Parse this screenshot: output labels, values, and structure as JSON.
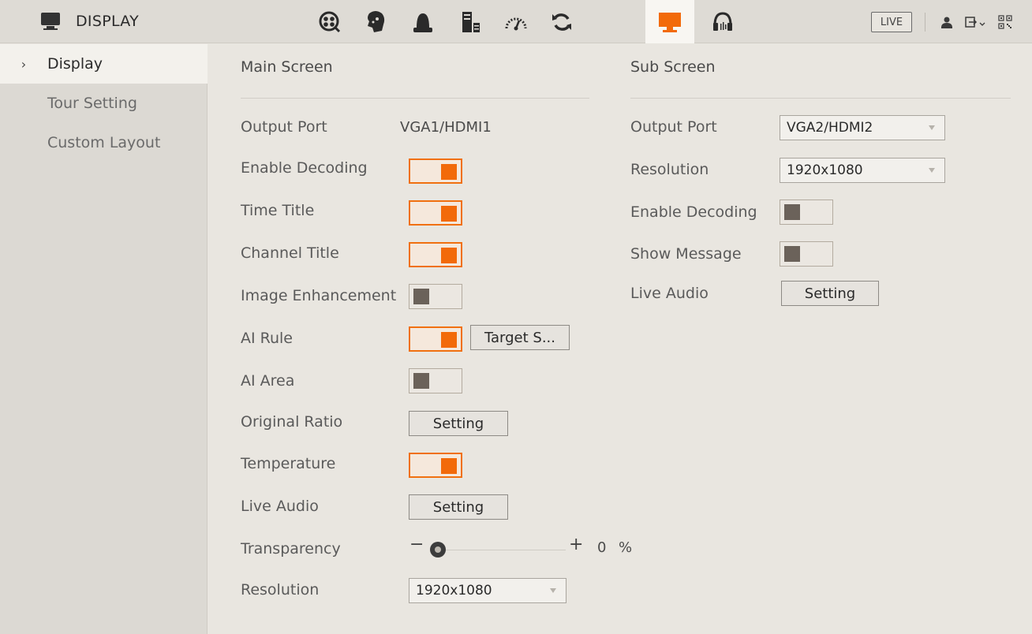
{
  "header": {
    "title": "DISPLAY",
    "nav_icons": [
      "search-video-icon",
      "face-ai-icon",
      "alarm-icon",
      "storage-icon",
      "network-speed-icon",
      "backup-icon",
      "display-icon",
      "audio-icon"
    ],
    "active_icon": "display-icon",
    "live_label": "LIVE",
    "right_icons": [
      "user-icon",
      "logout-icon",
      "qr-code-icon"
    ]
  },
  "sidebar": {
    "items": [
      {
        "label": "Display",
        "active": true
      },
      {
        "label": "Tour Setting",
        "active": false
      },
      {
        "label": "Custom Layout",
        "active": false
      }
    ]
  },
  "main_screen": {
    "title": "Main Screen",
    "output_port_label": "Output Port",
    "output_port_value": "VGA1/HDMI1",
    "enable_decoding_label": "Enable Decoding",
    "enable_decoding": true,
    "time_title_label": "Time Title",
    "time_title": true,
    "channel_title_label": "Channel Title",
    "channel_title": true,
    "image_enhancement_label": "Image Enhancement",
    "image_enhancement": false,
    "ai_rule_label": "AI Rule",
    "ai_rule": true,
    "ai_rule_button": "Target S...",
    "ai_area_label": "AI Area",
    "ai_area": false,
    "original_ratio_label": "Original Ratio",
    "original_ratio_button": "Setting",
    "temperature_label": "Temperature",
    "temperature": true,
    "live_audio_label": "Live Audio",
    "live_audio_button": "Setting",
    "transparency_label": "Transparency",
    "transparency_value": "0",
    "transparency_unit": "%",
    "resolution_label": "Resolution",
    "resolution_value": "1920x1080"
  },
  "sub_screen": {
    "title": "Sub Screen",
    "output_port_label": "Output Port",
    "output_port_value": "VGA2/HDMI2",
    "resolution_label": "Resolution",
    "resolution_value": "1920x1080",
    "enable_decoding_label": "Enable Decoding",
    "enable_decoding": false,
    "show_message_label": "Show Message",
    "show_message": false,
    "live_audio_label": "Live Audio",
    "live_audio_button": "Setting"
  },
  "colors": {
    "accent": "#f26a0a",
    "toggle_off_knob": "#6b625a"
  }
}
